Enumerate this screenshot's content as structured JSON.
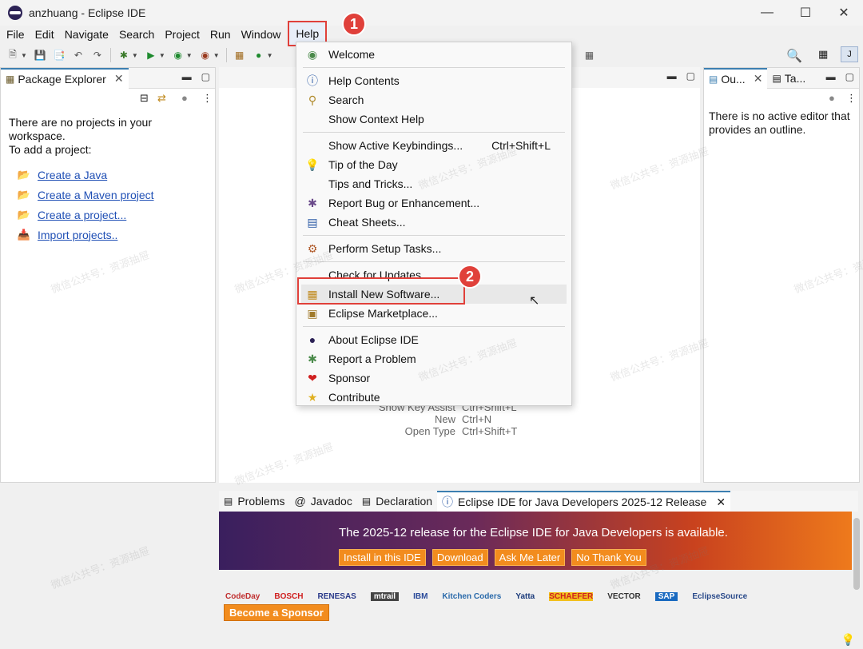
{
  "window": {
    "title": "anzhuang - Eclipse IDE"
  },
  "menubar": [
    "File",
    "Edit",
    "Navigate",
    "Search",
    "Project",
    "Run",
    "Window",
    "Help"
  ],
  "package_explorer": {
    "tab": "Package Explorer",
    "message_lines": [
      "There are no projects in your",
      "workspace.",
      "To add a project:"
    ],
    "links": [
      {
        "label": "Create a Java ",
        "icon": "java-project-icon"
      },
      {
        "label": "Create a Maven project",
        "icon": "maven-icon"
      },
      {
        "label": "Create a project...",
        "icon": "new-project-icon"
      },
      {
        "label": "Import projects..",
        "icon": "import-icon"
      }
    ]
  },
  "outline": {
    "tabs": [
      "Ou...",
      "Ta..."
    ],
    "message": "There is no active editor that provides an outline."
  },
  "help_menu": {
    "items": [
      {
        "label": "Welcome",
        "icon": "welcome-icon",
        "shortcut": ""
      },
      {
        "sep": true
      },
      {
        "label": "Help Contents",
        "icon": "help-icon",
        "shortcut": ""
      },
      {
        "label": "Search",
        "icon": "search-help-icon",
        "shortcut": ""
      },
      {
        "label": "Show Context Help",
        "icon": "",
        "shortcut": ""
      },
      {
        "sep": true
      },
      {
        "label": "Show Active Keybindings...",
        "icon": "",
        "shortcut": "Ctrl+Shift+L"
      },
      {
        "label": "Tip of the Day",
        "icon": "lightbulb-icon",
        "shortcut": ""
      },
      {
        "label": "Tips and Tricks...",
        "icon": "",
        "shortcut": ""
      },
      {
        "label": "Report Bug or Enhancement...",
        "icon": "bug-icon",
        "shortcut": ""
      },
      {
        "label": "Cheat Sheets...",
        "icon": "cheat-sheet-icon",
        "shortcut": ""
      },
      {
        "sep": true
      },
      {
        "label": "Perform Setup Tasks...",
        "icon": "setup-icon",
        "shortcut": ""
      },
      {
        "sep": true
      },
      {
        "label": "Check for Updates",
        "icon": "",
        "shortcut": ""
      },
      {
        "label": "Install New Software...",
        "icon": "install-icon",
        "shortcut": "",
        "highlight": true
      },
      {
        "label": "Eclipse Marketplace...",
        "icon": "marketplace-icon",
        "shortcut": ""
      },
      {
        "sep": true
      },
      {
        "label": "About Eclipse IDE",
        "icon": "eclipse-icon",
        "shortcut": ""
      },
      {
        "label": "Report a Problem",
        "icon": "problem-bug-icon",
        "shortcut": ""
      },
      {
        "label": "Sponsor",
        "icon": "heart-icon",
        "shortcut": ""
      },
      {
        "label": "Contribute",
        "icon": "star-icon",
        "shortcut": ""
      }
    ]
  },
  "editor_hints": [
    {
      "label": "Show Key Assist",
      "key": "Ctrl+Shift+L"
    },
    {
      "label": "New",
      "key": "Ctrl+N"
    },
    {
      "label": "Open Type",
      "key": "Ctrl+Shift+T"
    }
  ],
  "bottom_tabs": [
    "Problems",
    "Javadoc",
    "Declaration",
    "Eclipse IDE for Java Developers 2025-12 Release"
  ],
  "banner": {
    "message": "The 2025-12 release for the  Eclipse IDE for Java Developers is available.",
    "buttons": [
      "Install in this IDE",
      "Download",
      "Ask Me Later",
      "No Thank You"
    ]
  },
  "sponsors": [
    "CodeDay",
    "BOSCH",
    "RENESAS",
    "mtrail",
    "IBM",
    "Kitchen Coders",
    "Yatta",
    "SCHAEFER",
    "VECTOR",
    "SAP",
    "EclipseSource"
  ],
  "sponsor_button": "Become a Sponsor",
  "badges": [
    "1",
    "2"
  ],
  "watermark": "微信公共号：资源抽屉",
  "colors": {
    "accent_red": "#e0403a",
    "link": "#1f4fb5",
    "banner_orange": "#f28c1e"
  }
}
